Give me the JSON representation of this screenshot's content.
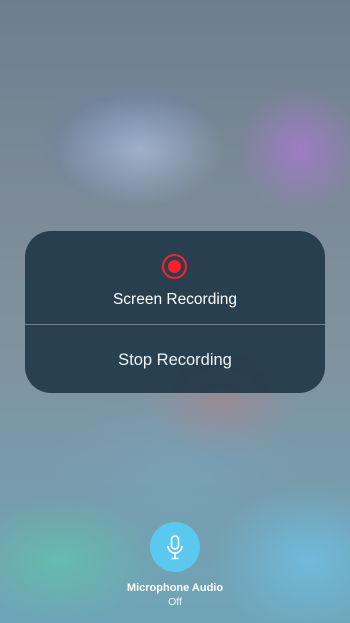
{
  "screen_recording": {
    "title": "Screen Recording",
    "record_icon": "record-icon",
    "record_color": "#ff1e2e",
    "stop_label": "Stop Recording"
  },
  "microphone": {
    "icon": "microphone-icon",
    "label": "Microphone Audio",
    "status": "Off",
    "accent": "#5bc8ef"
  }
}
